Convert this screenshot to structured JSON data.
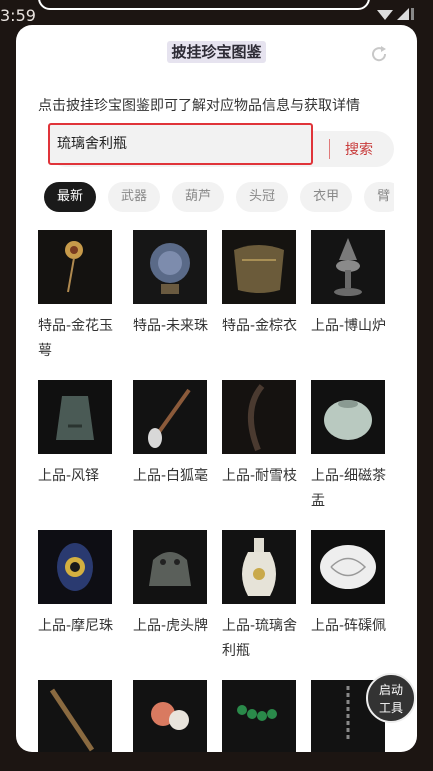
{
  "status": {
    "time": "3:59"
  },
  "header": {
    "title": "披挂珍宝图鉴"
  },
  "hint": "点击披挂珍宝图鉴即可了解对应物品信息与获取详情",
  "search": {
    "value": "琉璃舍利瓶",
    "button": "搜索"
  },
  "tabs": [
    "最新",
    "武器",
    "葫芦",
    "头冠",
    "衣甲",
    "臂"
  ],
  "items": [
    {
      "label": "特品-金花玉萼",
      "icon": "golden-hairpin"
    },
    {
      "label": "特品-未来珠",
      "icon": "orb"
    },
    {
      "label": "特品-金棕衣",
      "icon": "golden-robe"
    },
    {
      "label": "上品-博山炉",
      "icon": "incense-burner"
    },
    {
      "label": "上品-风铎",
      "icon": "bell"
    },
    {
      "label": "上品-白狐毫",
      "icon": "brush"
    },
    {
      "label": "上品-耐雪枝",
      "icon": "branch"
    },
    {
      "label": "上品-细磁茶盂",
      "icon": "tea-jar"
    },
    {
      "label": "上品-摩尼珠",
      "icon": "mani-pearl"
    },
    {
      "label": "上品-虎头牌",
      "icon": "tiger-token"
    },
    {
      "label": "上品-琉璃舍利瓶",
      "icon": "glaze-vase"
    },
    {
      "label": "上品-砗磲佩",
      "icon": "pendant"
    },
    {
      "label": "",
      "icon": "staff"
    },
    {
      "label": "",
      "icon": "coral"
    },
    {
      "label": "",
      "icon": "bead-string"
    },
    {
      "label": "",
      "icon": "chain"
    }
  ],
  "tool_button": {
    "line1": "启动",
    "line2": "工具"
  }
}
